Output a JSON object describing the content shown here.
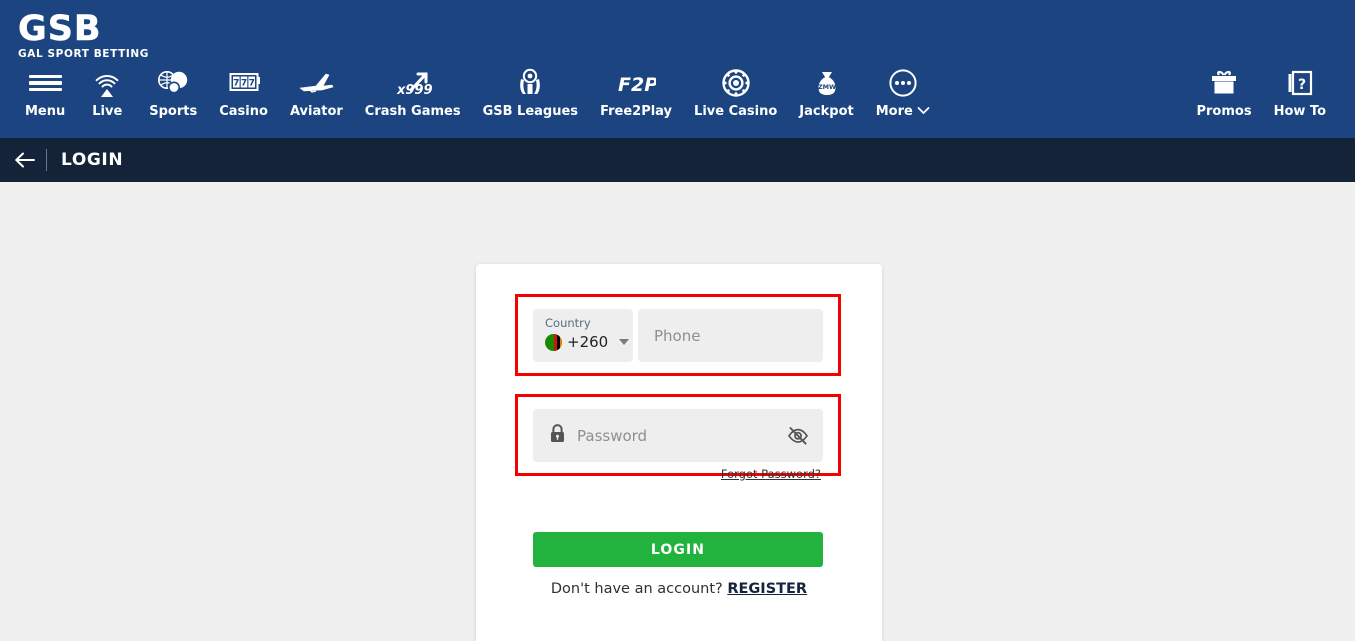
{
  "brand": {
    "logo_main": "GSB",
    "logo_sub": "GAL SPORT BETTING",
    "header_color": "#1b4480",
    "pagebar_color": "#152338",
    "accent_green": "#22b33e",
    "highlight_red": "#f40000"
  },
  "nav": {
    "left_items": [
      {
        "label": "Menu",
        "icon": "hamburger-menu-icon"
      },
      {
        "label": "Live",
        "icon": "live-broadcast-icon"
      },
      {
        "label": "Sports",
        "icon": "sports-balls-icon"
      },
      {
        "label": "Casino",
        "icon": "slot-machine-777-icon"
      },
      {
        "label": "Aviator",
        "icon": "airplane-icon"
      },
      {
        "label": "Crash Games",
        "icon": "x999-rocket-arrow-icon"
      },
      {
        "label": "GSB Leagues",
        "icon": "trophy-football-icon"
      },
      {
        "label": "Free2Play",
        "icon": "f2p-icon"
      },
      {
        "label": "Live Casino",
        "icon": "casino-chip-icon"
      },
      {
        "label": "Jackpot",
        "icon": "money-bag-zmw-icon"
      },
      {
        "label": "More",
        "icon": "ellipsis-circle-icon",
        "caret": true
      }
    ],
    "right_items": [
      {
        "label": "Promos",
        "icon": "gift-box-icon"
      },
      {
        "label": "How To",
        "icon": "question-book-icon"
      }
    ]
  },
  "pagebar": {
    "back_icon": "back-arrow-icon",
    "title": "LOGIN"
  },
  "form": {
    "country": {
      "label": "Country",
      "dial_code": "+260",
      "flag": "zambia-flag-icon",
      "caret_icon": "chevron-down-icon"
    },
    "phone": {
      "placeholder": "Phone",
      "value": ""
    },
    "password": {
      "placeholder": "Password",
      "value": "",
      "lock_icon": "lock-icon",
      "toggle_icon": "eye-off-icon"
    },
    "forgot_password": "Forgot Password?",
    "submit_label": "LOGIN",
    "register_prompt": "Don't have an account?",
    "register_link": "REGISTER"
  }
}
